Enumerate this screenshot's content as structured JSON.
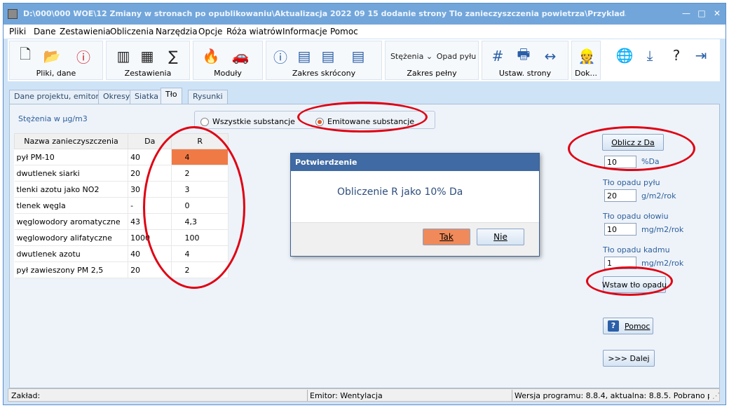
{
  "window": {
    "title": "D:\\000\\000 WOE\\12 Zmiany w stronach po opublikowaniu\\Aktualizacja 2022 09 15 dodanie strony Tlo zanieczyszczenia powietrza\\Przyklad.Operat"
  },
  "menu": [
    "Pliki",
    "Dane",
    "Zestawienia",
    "Obliczenia",
    "Narzędzia",
    "Opcje",
    "Róża wiatrów",
    "Informacje",
    "Pomoc"
  ],
  "toolbar": {
    "groups": [
      "Pliki, dane",
      "Zestawienia",
      "Moduły",
      "Zakres skrócony",
      "Zakres pełny",
      "Ustaw. strony",
      "Dok..."
    ],
    "stezenia": "Stężenia",
    "opad_pylu": "Opad pyłu"
  },
  "tabs": [
    "Dane projektu, emitory",
    "Okresy",
    "Siatka",
    "Tło",
    "Rysunki"
  ],
  "panel": {
    "unit_label": "Stężenia w µg/m3",
    "radio_all": "Wszystkie substancje",
    "radio_emit": "Emitowane substancje"
  },
  "table": {
    "headers": [
      "Nazwa zanieczyszczenia",
      "Da",
      "R"
    ],
    "rows": [
      {
        "name": "pył PM-10",
        "da": "40",
        "r": "4"
      },
      {
        "name": "dwutlenek siarki",
        "da": "20",
        "r": "2"
      },
      {
        "name": "tlenki azotu jako NO2",
        "da": "30",
        "r": "3"
      },
      {
        "name": "tlenek węgla",
        "da": "-",
        "r": "0"
      },
      {
        "name": "węglowodory aromatyczne",
        "da": "43",
        "r": "4,3"
      },
      {
        "name": "węglowodory alifatyczne",
        "da": "1000",
        "r": "100"
      },
      {
        "name": "dwutlenek azotu",
        "da": "40",
        "r": "4"
      },
      {
        "name": "pył zawieszony PM 2,5",
        "da": "20",
        "r": "2"
      }
    ]
  },
  "dialog": {
    "title": "Potwierdzenie",
    "message": "Obliczenie R jako 10% Da",
    "yes": "Tak",
    "no": "Nie"
  },
  "right": {
    "calc_button": "Oblicz z Da",
    "pct_value": "10",
    "pct_unit": "%Da",
    "dust_label": "Tło opadu pyłu",
    "dust_value": "20",
    "dust_unit": "g/m2/rok",
    "lead_label": "Tło opadu ołowiu",
    "lead_value": "10",
    "lead_unit": "mg/m2/rok",
    "cadmium_label": "Tło opadu kadmu",
    "cadmium_value": "1",
    "cadmium_unit": "mg/m2/rok",
    "insert_button": "Wstaw tło opadu",
    "help_button": "Pomoc",
    "next_button": ">>> Dalej"
  },
  "status": {
    "zaklad": "Zakład:",
    "emitor": "Emitor: Wentylacja",
    "version": "Wersja programu: 8.8.4,  aktualna: 8.8.5. Pobrano plik do"
  },
  "colors": {
    "accent": "#f07a45",
    "annotation": "#e00012"
  }
}
